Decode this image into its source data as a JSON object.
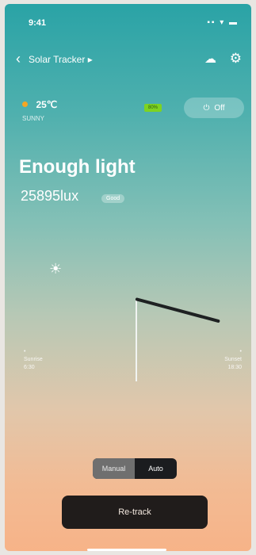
{
  "status_bar": {
    "time": "9:41",
    "icons": "▪▪ ▾ ▬"
  },
  "nav": {
    "back": "‹",
    "title": "Solar Tracker ▸",
    "cloud_icon": "☁",
    "gear_icon": "⚙"
  },
  "weather": {
    "temp": "25℃",
    "label": "SUNNY"
  },
  "battery_label": "80%",
  "power": {
    "icon": "⏻",
    "label": "Off"
  },
  "light": {
    "title": "Enough light",
    "lux": "25895lux",
    "badge": "Good"
  },
  "sun_icon": "☀",
  "sunrise": {
    "marker": "•",
    "label": "Sunrise",
    "time": "6:30"
  },
  "sunset": {
    "marker": "•",
    "label": "Sunset",
    "time": "18:30"
  },
  "modes": {
    "manual": "Manual",
    "auto": "Auto"
  },
  "retrack_label": "Re-track"
}
